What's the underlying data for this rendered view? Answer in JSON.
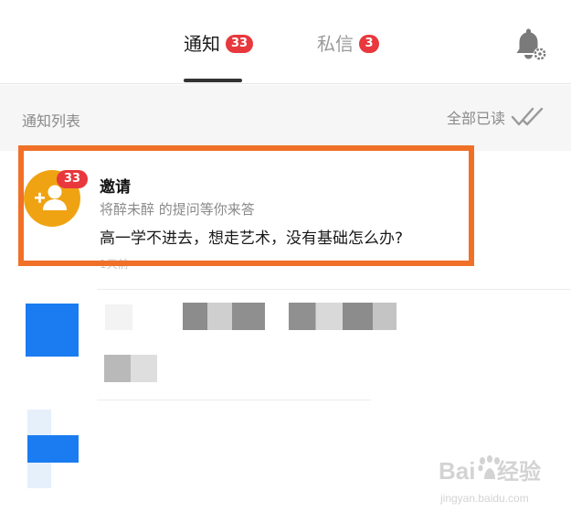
{
  "colors": {
    "accent_red": "#e8383d",
    "highlight_orange": "#f07028",
    "avatar_orange": "#f0a312",
    "blue": "#1a7cf0"
  },
  "tabs": [
    {
      "label": "通知",
      "badge": "33",
      "active": true
    },
    {
      "label": "私信",
      "badge": "3",
      "active": false
    }
  ],
  "header": {
    "settings_icon": "bell-gear-icon"
  },
  "list": {
    "title": "通知列表",
    "mark_all_read": "全部已读",
    "mark_all_icon": "double-check-icon"
  },
  "notification": {
    "avatar_icon": "add-user-icon",
    "badge": "33",
    "title": "邀请",
    "subtitle": "将醉未醉 的提问等你来答",
    "question": "高一学不进去，想走艺术，没有基础怎么办?",
    "time": "1天前"
  },
  "watermark": {
    "brand": "Baidu经验",
    "url": "jingyan.baidu.com"
  }
}
